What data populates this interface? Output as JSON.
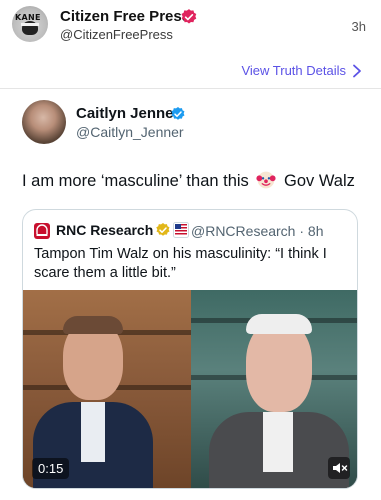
{
  "truth_post": {
    "author_name": "Citizen Free Press",
    "author_handle": "@CitizenFreePress",
    "time": "3h",
    "view_details_link": "View Truth Details",
    "avatar_text": "KANE"
  },
  "tweet": {
    "author_name": "Caitlyn Jenner",
    "author_handle": "@Caitlyn_Jenner",
    "text_before_emoji": "I am more ‘masculine’ than this",
    "text_after_emoji": "Gov Walz",
    "emoji_icon": "clown-face-icon"
  },
  "quoted_tweet": {
    "author_name": "RNC Research",
    "author_handle": "@RNCResearch",
    "time": "8h",
    "handle_time": "@RNCResearch · 8h",
    "text": "Tampon Tim Walz on his masculinity: “I think I scare them a little bit.”",
    "video_duration": "0:15"
  },
  "colors": {
    "verified_red": "#e0245e",
    "verified_blue": "#1d9bf0",
    "gold_badge": "#e2b719",
    "link_purple": "#5b52e6",
    "rnc_red": "#c8102e"
  }
}
